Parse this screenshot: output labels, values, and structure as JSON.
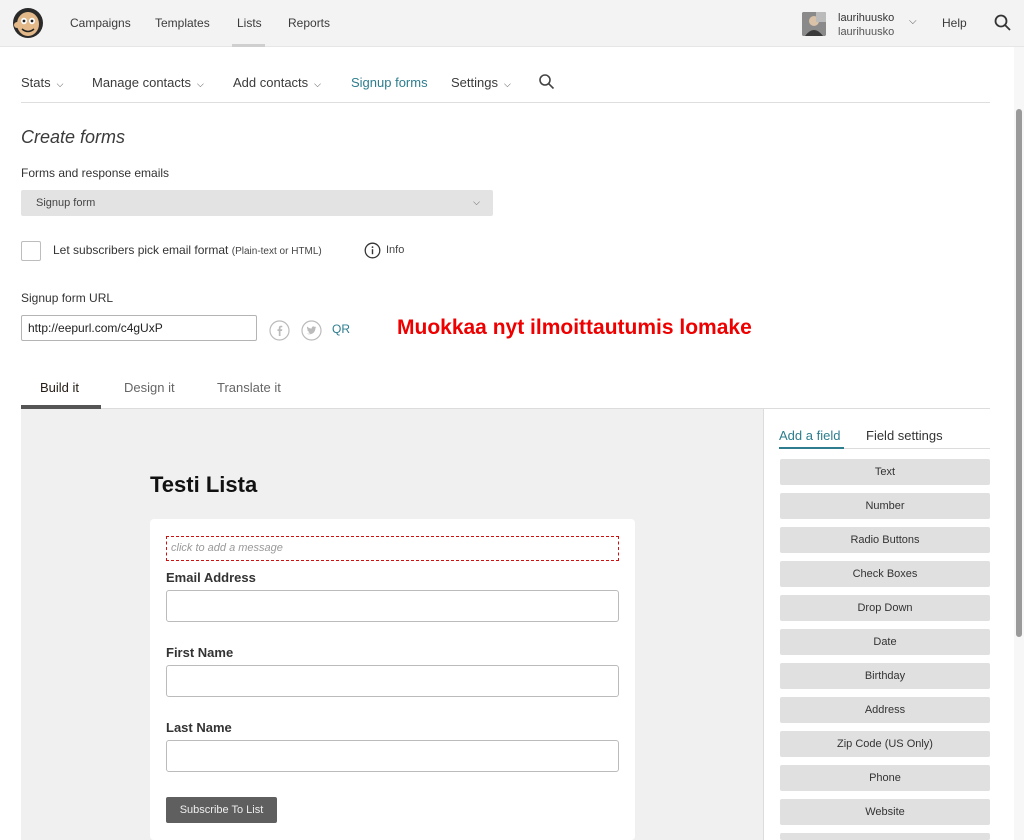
{
  "topnav": {
    "items": [
      "Campaigns",
      "Templates",
      "Lists",
      "Reports"
    ],
    "active": "Lists",
    "user": {
      "name": "laurihuusko",
      "account": "laurihuusko"
    },
    "help": "Help"
  },
  "subnav": {
    "items": [
      {
        "label": "Stats",
        "dropdown": true
      },
      {
        "label": "Manage contacts",
        "dropdown": true
      },
      {
        "label": "Add contacts",
        "dropdown": true
      },
      {
        "label": "Signup forms",
        "dropdown": false
      },
      {
        "label": "Settings",
        "dropdown": true
      }
    ],
    "active": "Signup forms"
  },
  "page": {
    "heading": "Create forms",
    "forms_label": "Forms and response emails",
    "forms_select": "Signup form",
    "pick_format_label": "Let subscribers pick email format",
    "pick_format_note": "(Plain-text or HTML)",
    "pick_format_checked": false,
    "info": "Info",
    "url_label": "Signup form URL",
    "url_value": "http://eepurl.com/c4gUxP",
    "qr": "QR",
    "annotation": "Muokkaa nyt ilmoittautumis lomake"
  },
  "tabs": [
    "Build it",
    "Design it",
    "Translate it"
  ],
  "active_tab": "Build it",
  "form_preview": {
    "title": "Testi Lista",
    "message_placeholder": "click to add a message",
    "fields": [
      "Email Address",
      "First Name",
      "Last Name"
    ],
    "submit": "Subscribe To List"
  },
  "right_panel": {
    "tabs": [
      "Add a field",
      "Field settings"
    ],
    "active_tab": "Add a field",
    "field_types": [
      "Text",
      "Number",
      "Radio Buttons",
      "Check Boxes",
      "Drop Down",
      "Date",
      "Birthday",
      "Address",
      "Zip Code (US Only)",
      "Phone",
      "Website"
    ]
  },
  "colors": {
    "accent": "#2d7d8e",
    "annotation": "#ee0000",
    "topbar": "#f3f3f3"
  },
  "icons": [
    "mailchimp-logo-icon",
    "search-icon",
    "chevron-down-icon",
    "info-icon",
    "facebook-icon",
    "twitter-icon"
  ]
}
